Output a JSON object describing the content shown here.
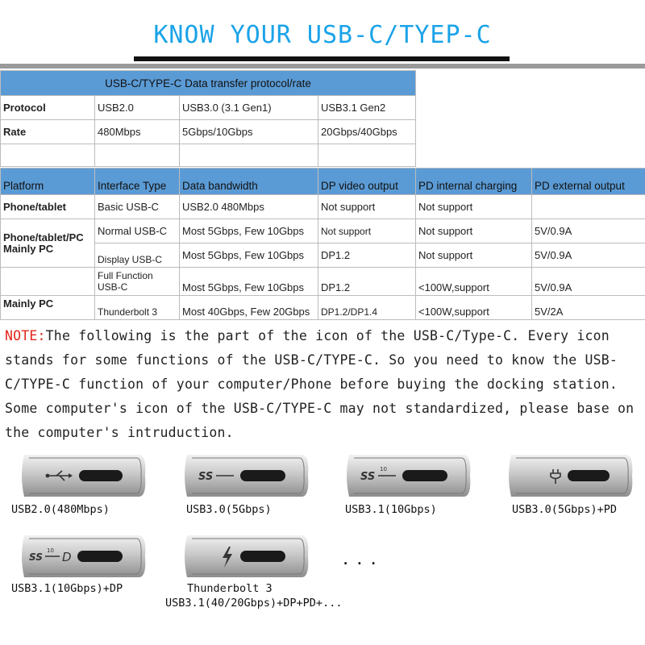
{
  "header": {
    "title": "KNOW YOUR USB-C/TYEP-C"
  },
  "table1": {
    "title": "USB-C/TYPE-C Data transfer protocol/rate",
    "rows": [
      {
        "label": "Protocol",
        "cells": [
          "USB2.0",
          "USB3.0  (3.1 Gen1)",
          "USB3.1 Gen2"
        ]
      },
      {
        "label": "Rate",
        "cells": [
          "480Mbps",
          "5Gbps/10Gbps",
          "20Gbps/40Gbps"
        ]
      }
    ]
  },
  "table2": {
    "headers": [
      "Platform",
      "Interface Type",
      "Data bandwidth",
      "DP video output",
      "PD internal charging",
      "PD external output"
    ],
    "platforms": {
      "phone_tablet": "Phone/tablet",
      "phone_tablet_pc": "Phone/tablet/PC",
      "mainly_pc_1": "Mainly PC",
      "mainly_pc_2": "Mainly PC"
    },
    "rows": [
      {
        "interface": "Basic USB-C",
        "bandwidth": "USB2.0 480Mbps",
        "dp": "Not support",
        "pd_in": "Not support",
        "pd_out": ""
      },
      {
        "interface": "Normal USB-C",
        "bandwidth": "Most 5Gbps, Few 10Gbps",
        "dp": "Not support",
        "pd_in": "Not support",
        "pd_out": "5V/0.9A"
      },
      {
        "interface": "Display USB-C",
        "bandwidth": "Most 5Gbps, Few 10Gbps",
        "dp": "DP1.2",
        "pd_in": "Not support",
        "pd_out": "5V/0.9A"
      },
      {
        "interface_line1": "Full Function",
        "interface_line2": "USB-C",
        "bandwidth": "Most 5Gbps, Few 10Gbps",
        "dp": "DP1.2",
        "pd_in": "<100W,support",
        "pd_out": "5V/0.9A"
      },
      {
        "interface": "Thunderbolt 3",
        "bandwidth": "Most 40Gbps, Few 20Gbps",
        "dp": "DP1.2/DP1.4",
        "pd_in": "<100W,support",
        "pd_out": "5V/2A"
      }
    ]
  },
  "note": {
    "label": "NOTE:",
    "text": "The following is the part of the icon of the USB-C/Type-C. Every icon stands for some functions of the USB-C/TYPE-C. So you need to know the USB-C/TYPE-C function of your computer/Phone before buying the docking station. Some computer's icon of the USB-C/TYPE-C may not standardized, please base on the computer's intruduction."
  },
  "ports": [
    {
      "icon": "usb-trident-icon",
      "caption": "USB2.0(480Mbps)"
    },
    {
      "icon": "superspeed-icon",
      "caption": "USB3.0(5Gbps)"
    },
    {
      "icon": "superspeed-10-icon",
      "badge": "10",
      "caption": "USB3.1(10Gbps)"
    },
    {
      "icon": "power-delivery-icon",
      "caption": "USB3.0(5Gbps)+PD"
    },
    {
      "icon": "superspeed-10-dp-icon",
      "badge": "10",
      "caption": "USB3.1(10Gbps)+DP"
    },
    {
      "icon": "thunderbolt-icon",
      "caption": "Thunderbolt 3",
      "caption2": "USB3.1(40/20Gbps)+DP+PD+..."
    }
  ],
  "more": "..."
}
